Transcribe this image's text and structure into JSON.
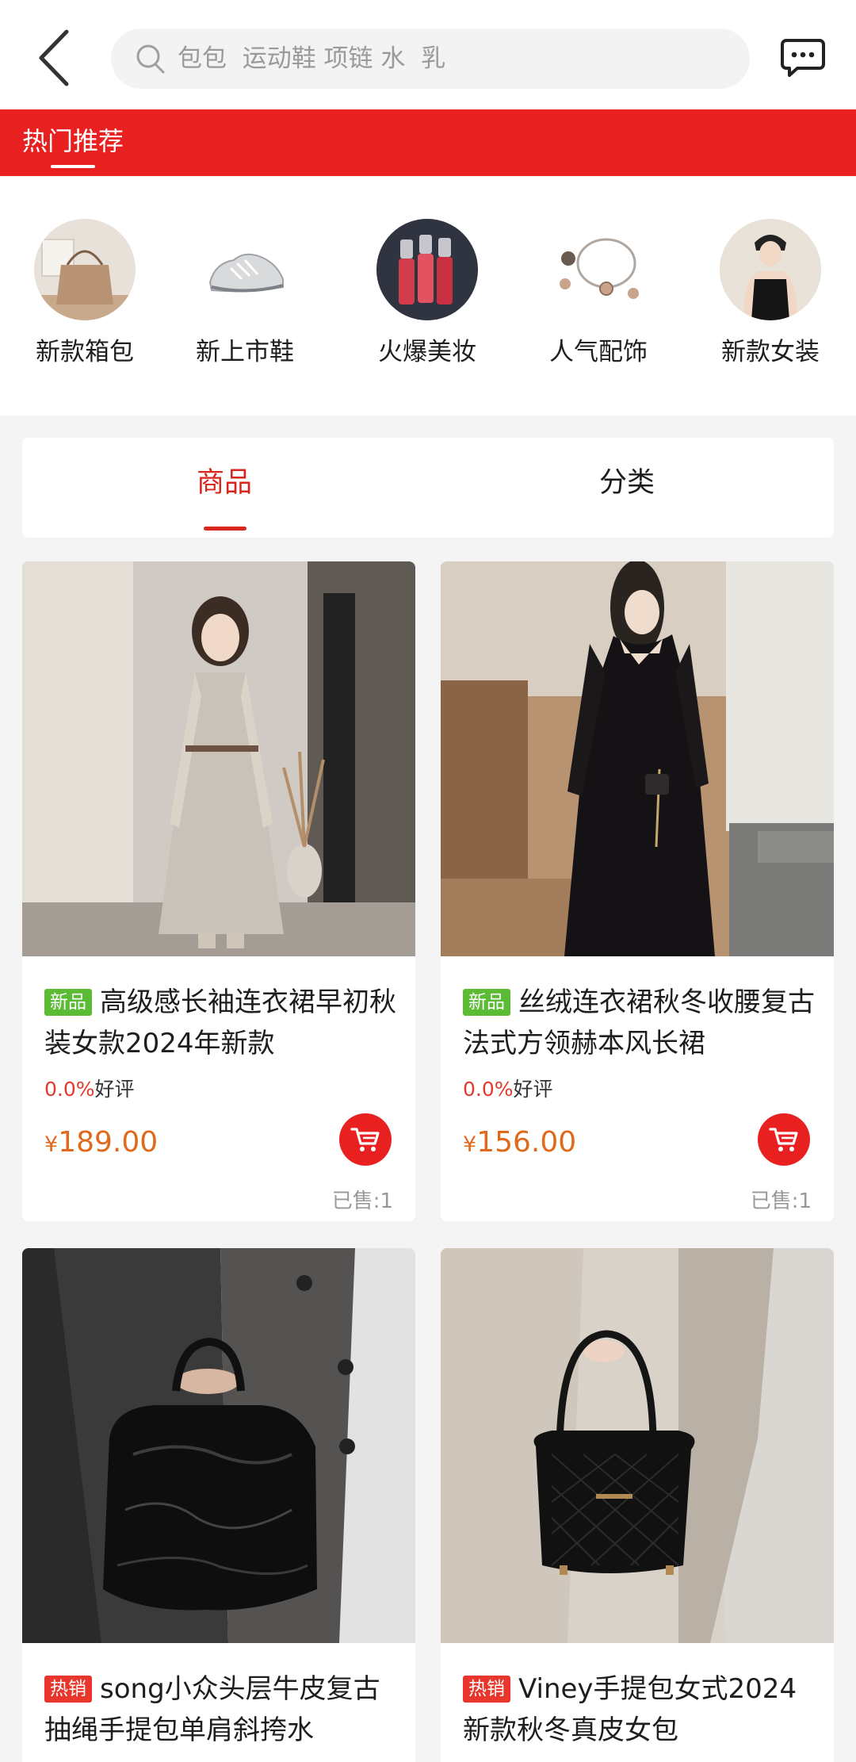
{
  "header": {
    "search_placeholder": "包包  运动鞋 项链 水  乳"
  },
  "hot_tab": {
    "label": "热门推荐"
  },
  "categories": [
    {
      "label": "新款箱包",
      "icon": "handbag-thumb"
    },
    {
      "label": "新上市鞋",
      "icon": "sneaker-thumb"
    },
    {
      "label": "火爆美妆",
      "icon": "lip-gloss-thumb"
    },
    {
      "label": "人气配饰",
      "icon": "necklace-thumb"
    },
    {
      "label": "新款女装",
      "icon": "women-wear-thumb"
    }
  ],
  "tabs": {
    "goods": "商品",
    "categories": "分类",
    "active": "商品"
  },
  "products": [
    {
      "badge": "新品",
      "title": "高级感长袖连衣裙早初秋装女款2024年新款",
      "rating_pct": "0.0%",
      "rating_label": "好评",
      "currency": "¥",
      "price": "189.00",
      "sold": "已售:1"
    },
    {
      "badge": "新品",
      "title": "丝绒连衣裙秋冬收腰复古法式方领赫本风长裙",
      "rating_pct": "0.0%",
      "rating_label": "好评",
      "currency": "¥",
      "price": "156.00",
      "sold": "已售:1"
    },
    {
      "badge": "热销",
      "title": "song小众头层牛皮复古抽绳手提包单肩斜挎水"
    },
    {
      "badge": "热销",
      "title": "Viney手提包女式2024新款秋冬真皮女包"
    }
  ],
  "colors": {
    "brand_red": "#e8201f",
    "price_orange": "#e06a1c",
    "new_badge": "#5bbb34"
  }
}
